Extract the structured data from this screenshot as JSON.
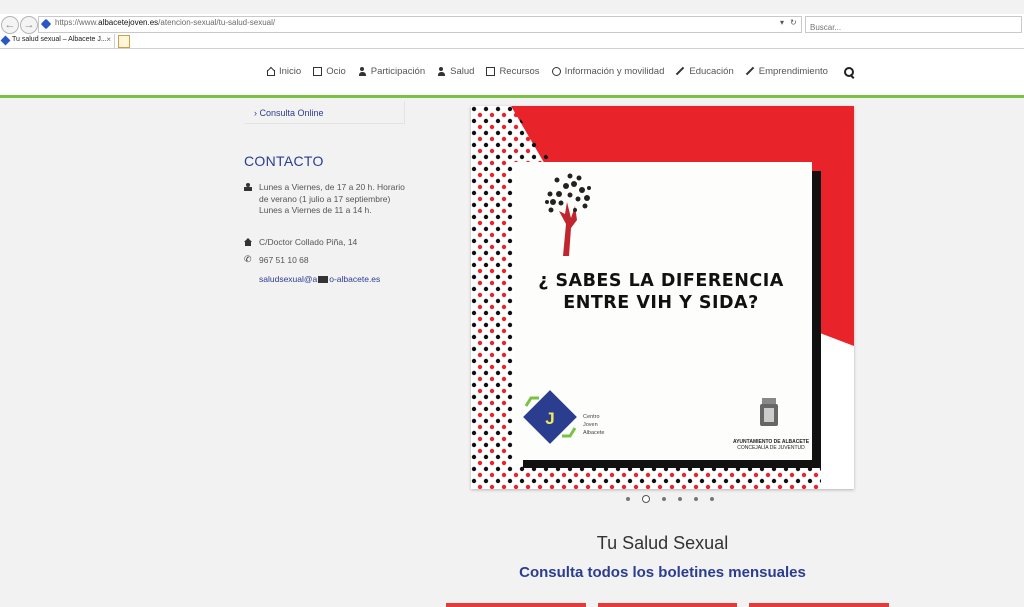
{
  "browser": {
    "url_prefix": "https://www.",
    "url_domain": "albacetejoven.es",
    "url_path": "/atencion-sexual/tu-salud-sexual/",
    "search_placeholder": "Buscar...",
    "tab_title": "Tu salud sexual – Albacete J...",
    "tab_close": "×",
    "back_glyph": "←",
    "forward_glyph": "→",
    "dropdown_glyph": "▾",
    "refresh_glyph": "↻"
  },
  "nav": {
    "items": [
      {
        "label": "Inicio",
        "icon": "home-icon"
      },
      {
        "label": "Ocio",
        "icon": "music-icon"
      },
      {
        "label": "Participación",
        "icon": "people-icon"
      },
      {
        "label": "Salud",
        "icon": "health-icon"
      },
      {
        "label": "Recursos",
        "icon": "document-icon"
      },
      {
        "label": "Información y movilidad",
        "icon": "info-icon"
      },
      {
        "label": "Educación",
        "icon": "pencil-icon"
      },
      {
        "label": "Emprendimiento",
        "icon": "rocket-icon"
      }
    ],
    "search_icon": "search-icon"
  },
  "sidebar": {
    "link_chevron": "›",
    "link_label": "Consulta Online",
    "contact_title": "CONTACTO",
    "hours": "Lunes a Viernes, de 17 a 20 h. Horario de verano (1 julio a 17 septiembre) Lunes a Viernes de 11 a 14 h.",
    "address": "C/Doctor Collado Piña, 14",
    "phone": "967 51 10 68",
    "email_left": "saludsexual@a",
    "email_right": "o-albacete.es"
  },
  "slide": {
    "title": "¿ SABES LA DIFERENCIA ENTRE VIH Y SIDA?",
    "logo_letter": "J",
    "logo_words": [
      "Centro",
      "Joven",
      "Albacete"
    ],
    "ayto_title": "AYUNTAMIENTO DE ALBACETE",
    "ayto_sub": "CONCEJALÍA DE JUVENTUD",
    "slide_count": 6,
    "active_slide": 2
  },
  "main": {
    "heading": "Tu Salud Sexual",
    "subheading": "Consulta todos los boletines mensuales"
  },
  "colors": {
    "brand_blue": "#2b3d8f",
    "accent_green": "#7cc242",
    "slide_red": "#e8242a"
  }
}
